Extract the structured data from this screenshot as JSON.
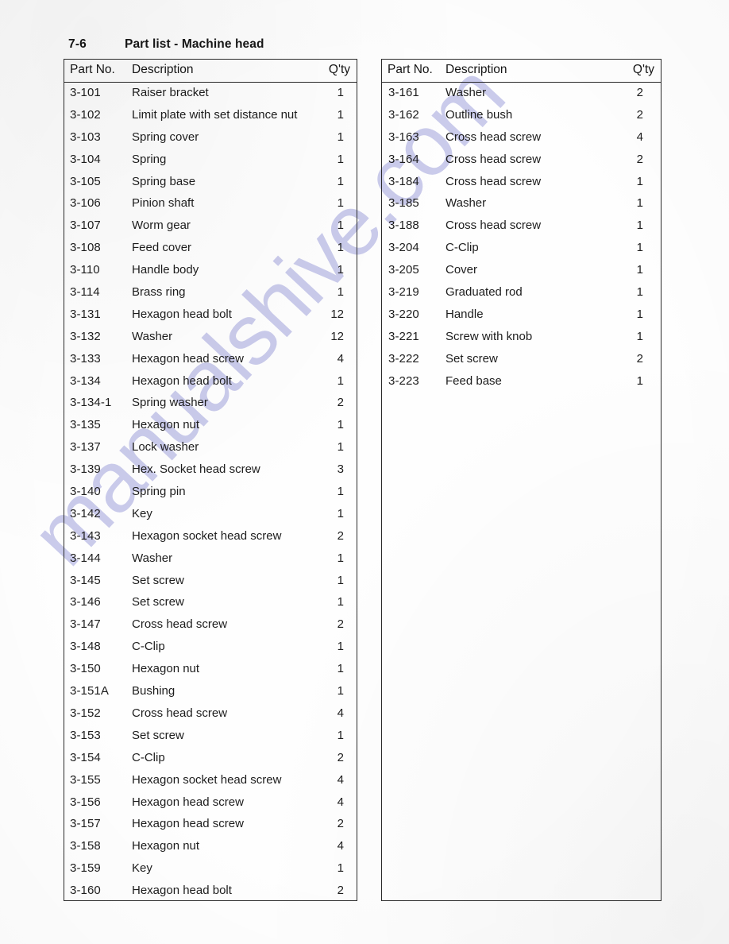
{
  "header": {
    "page_number": "7-6",
    "title": "Part list - Machine head"
  },
  "watermark": {
    "text": "manualshive.com",
    "color": "#c6c7ea"
  },
  "columns": {
    "part_no": "Part No.",
    "description": "Description",
    "qty": "Q'ty"
  },
  "left_table": {
    "rows": [
      {
        "part_no": "3-101",
        "description": "Raiser bracket",
        "qty": "1"
      },
      {
        "part_no": "3-102",
        "description": "Limit plate with set distance nut",
        "qty": "1"
      },
      {
        "part_no": "3-103",
        "description": "Spring cover",
        "qty": "1"
      },
      {
        "part_no": "3-104",
        "description": "Spring",
        "qty": "1"
      },
      {
        "part_no": "3-105",
        "description": "Spring base",
        "qty": "1"
      },
      {
        "part_no": "3-106",
        "description": "Pinion shaft",
        "qty": "1"
      },
      {
        "part_no": "3-107",
        "description": "Worm gear",
        "qty": "1"
      },
      {
        "part_no": "3-108",
        "description": "Feed cover",
        "qty": "1"
      },
      {
        "part_no": "3-110",
        "description": "Handle body",
        "qty": "1"
      },
      {
        "part_no": "3-114",
        "description": "Brass ring",
        "qty": "1"
      },
      {
        "part_no": "3-131",
        "description": "Hexagon head bolt",
        "qty": "12"
      },
      {
        "part_no": "3-132",
        "description": "Washer",
        "qty": "12"
      },
      {
        "part_no": "3-133",
        "description": "Hexagon head screw",
        "qty": "4"
      },
      {
        "part_no": "3-134",
        "description": "Hexagon head bolt",
        "qty": "1"
      },
      {
        "part_no": "3-134-1",
        "description": "Spring washer",
        "qty": "2"
      },
      {
        "part_no": "3-135",
        "description": "Hexagon nut",
        "qty": "1"
      },
      {
        "part_no": "3-137",
        "description": "Lock washer",
        "qty": "1"
      },
      {
        "part_no": "3-139",
        "description": "Hex. Socket head screw",
        "qty": "3"
      },
      {
        "part_no": "3-140",
        "description": "Spring pin",
        "qty": "1"
      },
      {
        "part_no": "3-142",
        "description": "Key",
        "qty": "1"
      },
      {
        "part_no": "3-143",
        "description": "Hexagon socket head screw",
        "qty": "2"
      },
      {
        "part_no": "3-144",
        "description": "Washer",
        "qty": "1"
      },
      {
        "part_no": "3-145",
        "description": "Set screw",
        "qty": "1"
      },
      {
        "part_no": "3-146",
        "description": "Set screw",
        "qty": "1"
      },
      {
        "part_no": "3-147",
        "description": "Cross head screw",
        "qty": "2"
      },
      {
        "part_no": "3-148",
        "description": "C-Clip",
        "qty": "1"
      },
      {
        "part_no": "3-150",
        "description": "Hexagon nut",
        "qty": "1"
      },
      {
        "part_no": "3-151A",
        "description": "Bushing",
        "qty": "1"
      },
      {
        "part_no": "3-152",
        "description": "Cross head screw",
        "qty": "4"
      },
      {
        "part_no": "3-153",
        "description": "Set screw",
        "qty": "1"
      },
      {
        "part_no": "3-154",
        "description": "C-Clip",
        "qty": "2"
      },
      {
        "part_no": "3-155",
        "description": "Hexagon socket head screw",
        "qty": "4"
      },
      {
        "part_no": "3-156",
        "description": "Hexagon head screw",
        "qty": "4"
      },
      {
        "part_no": "3-157",
        "description": "Hexagon head screw",
        "qty": "2"
      },
      {
        "part_no": "3-158",
        "description": "Hexagon nut",
        "qty": "4"
      },
      {
        "part_no": "3-159",
        "description": "Key",
        "qty": "1"
      },
      {
        "part_no": "3-160",
        "description": "Hexagon head bolt",
        "qty": "2"
      }
    ]
  },
  "right_table": {
    "rows": [
      {
        "part_no": "3-161",
        "description": "Washer",
        "qty": "2"
      },
      {
        "part_no": "3-162",
        "description": "Outline bush",
        "qty": "2"
      },
      {
        "part_no": "3-163",
        "description": "Cross head screw",
        "qty": "4"
      },
      {
        "part_no": "3-164",
        "description": "Cross head screw",
        "qty": "2"
      },
      {
        "part_no": "3-184",
        "description": "Cross head screw",
        "qty": "1"
      },
      {
        "part_no": "3-185",
        "description": "Washer",
        "qty": "1"
      },
      {
        "part_no": "3-188",
        "description": "Cross head screw",
        "qty": "1"
      },
      {
        "part_no": "3-204",
        "description": "C-Clip",
        "qty": "1"
      },
      {
        "part_no": "3-205",
        "description": "Cover",
        "qty": "1"
      },
      {
        "part_no": "3-219",
        "description": "Graduated rod",
        "qty": "1"
      },
      {
        "part_no": "3-220",
        "description": "Handle",
        "qty": "1"
      },
      {
        "part_no": "3-221",
        "description": "Screw with knob",
        "qty": "1"
      },
      {
        "part_no": "3-222",
        "description": "Set screw",
        "qty": "2"
      },
      {
        "part_no": "3-223",
        "description": "Feed base",
        "qty": "1"
      }
    ]
  }
}
